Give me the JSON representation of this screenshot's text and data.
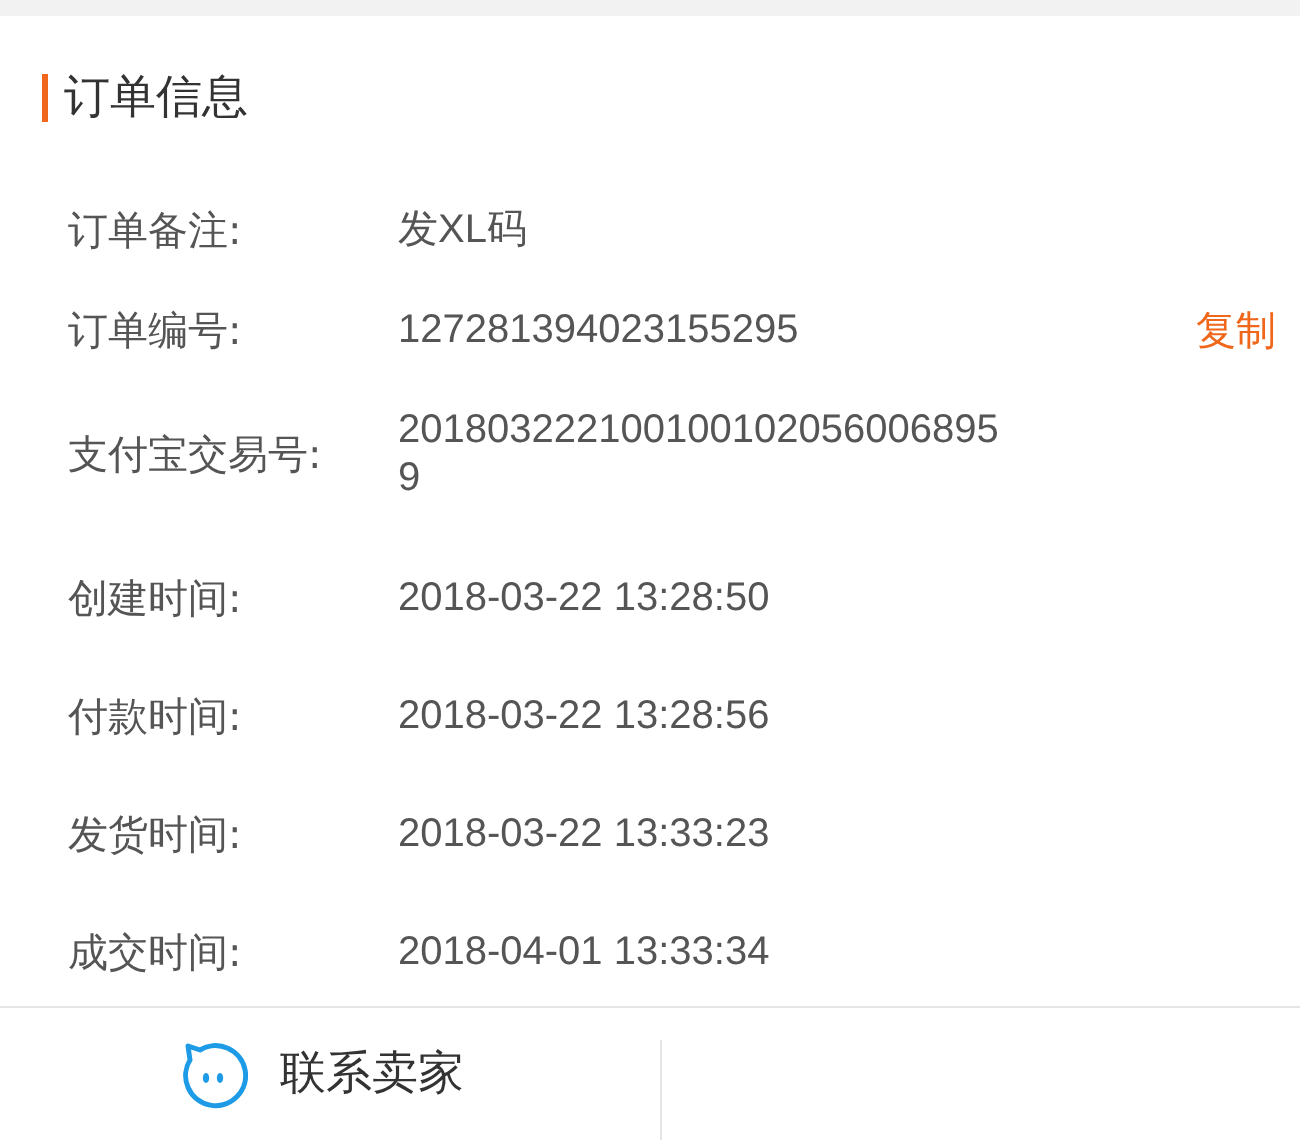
{
  "section": {
    "title": "订单信息"
  },
  "fields": [
    {
      "label": "订单备注:",
      "value": "发XL码"
    },
    {
      "label": "订单编号:",
      "value": "127281394023155295",
      "action": "复制"
    },
    {
      "label": "支付宝交易号:",
      "value": "2018032221001001020560068959"
    },
    {
      "label": "创建时间:",
      "value": "2018-03-22 13:28:50"
    },
    {
      "label": "付款时间:",
      "value": "2018-03-22 13:28:56"
    },
    {
      "label": "发货时间:",
      "value": "2018-03-22 13:33:23"
    },
    {
      "label": "成交时间:",
      "value": "2018-04-01 13:33:34"
    }
  ],
  "footer": {
    "buttons": [
      {
        "label": "联系卖家"
      }
    ]
  }
}
